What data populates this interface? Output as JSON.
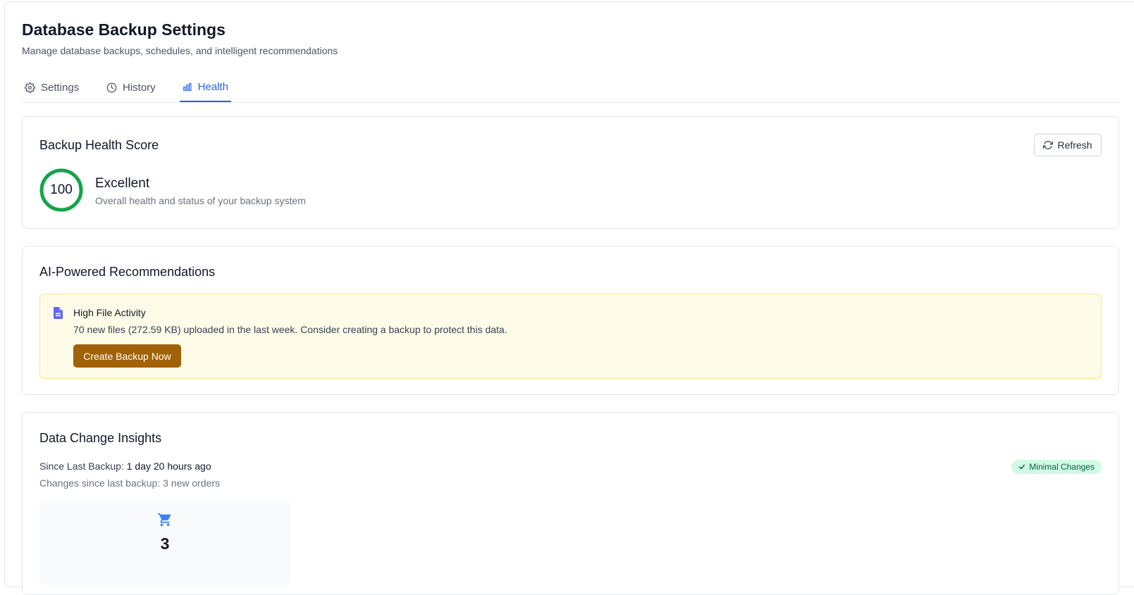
{
  "header": {
    "title": "Database Backup Settings",
    "subtitle": "Manage database backups, schedules, and intelligent recommendations"
  },
  "tabs": [
    {
      "label": "Settings",
      "icon": "gear-icon",
      "active": false
    },
    {
      "label": "History",
      "icon": "clock-icon",
      "active": false
    },
    {
      "label": "Health",
      "icon": "bar-chart-icon",
      "active": true
    }
  ],
  "health": {
    "title": "Backup Health Score",
    "refresh_label": "Refresh",
    "score": "100",
    "score_fraction": 1.0,
    "status": "Excellent",
    "description": "Overall health and status of your backup system",
    "ring_color": "#16a34a"
  },
  "recommendations": {
    "title": "AI-Powered Recommendations",
    "items": [
      {
        "icon": "document-icon",
        "title": "High File Activity",
        "text": "70 new files (272.59 KB) uploaded in the last week. Consider creating a backup to protect this data.",
        "action_label": "Create Backup Now"
      }
    ]
  },
  "insights": {
    "title": "Data Change Insights",
    "since_label": "Since Last Backup:",
    "since_value": "1 day 20 hours ago",
    "changes_text": "Changes since last backup: 3 new orders",
    "badge": "Minimal Changes",
    "stats": [
      {
        "icon": "shopping-cart-icon",
        "value": "3"
      }
    ]
  },
  "colors": {
    "accent": "#2563eb",
    "success": "#16a34a",
    "warning_bg": "#fefce8",
    "action": "#a16207"
  }
}
